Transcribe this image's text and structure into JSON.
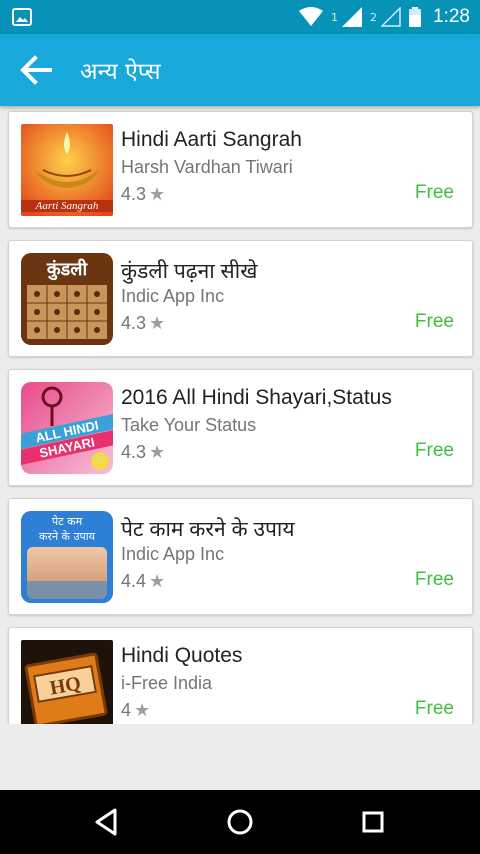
{
  "status": {
    "sim1": "1",
    "sim2": "2",
    "time": "1:28"
  },
  "header": {
    "title": "अन्य ऐप्स"
  },
  "apps": [
    {
      "name": "Hindi Aarti Sangrah",
      "developer": "Harsh Vardhan Tiwari",
      "rating": "4.3",
      "price": "Free",
      "icon_text": "Aarti Sangrah"
    },
    {
      "name": "कुंडली पढ़ना सीखे",
      "developer": "Indic App Inc",
      "rating": "4.3",
      "price": "Free",
      "icon_text": "कुंडली"
    },
    {
      "name": "2016 All Hindi Shayari,Status",
      "developer": "Take Your Status",
      "rating": "4.3",
      "price": "Free",
      "icon_text_1": "ALL HINDI",
      "icon_text_2": "SHAYARI"
    },
    {
      "name": "पेट काम करने के उपाय",
      "developer": "Indic App Inc",
      "rating": "4.4",
      "price": "Free",
      "icon_text_1": "पेट कम",
      "icon_text_2": "करने के उपाय"
    },
    {
      "name": "Hindi Quotes",
      "developer": "i-Free India",
      "rating": "4",
      "price": "Free",
      "icon_text": "HQ"
    }
  ],
  "colors": {
    "statusbar": "#0792b8",
    "appbar": "#18a8da",
    "price": "#3fbf3f"
  },
  "icons": [
    "image-icon",
    "wifi-icon",
    "signal-icon",
    "battery-icon",
    "back-arrow-icon",
    "star-icon",
    "back-triangle-icon",
    "home-circle-icon",
    "recents-square-icon"
  ]
}
